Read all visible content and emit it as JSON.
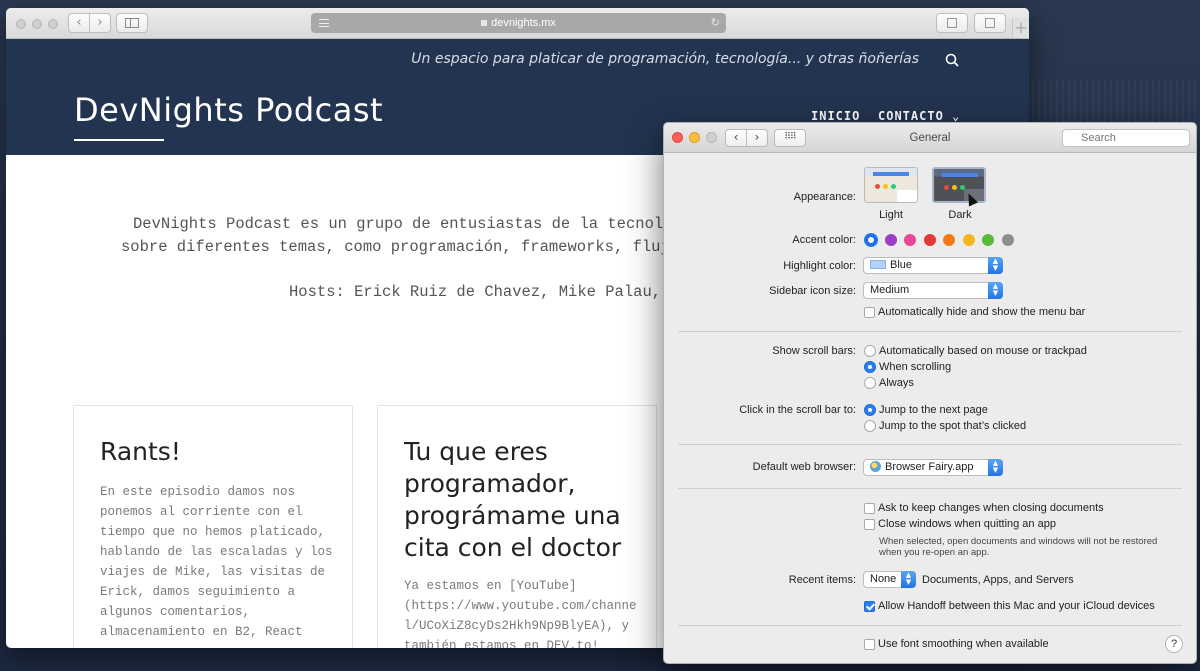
{
  "browser": {
    "url": "devnights.mx",
    "back_label": "‹",
    "forward_label": "›",
    "new_tab_label": "+"
  },
  "site": {
    "tagline": "Un espacio para platicar de programación, tecnología... y otras ñoñerías",
    "title": "DevNights Podcast",
    "nav": [
      "INICIO",
      "CONTACTO ⌄"
    ],
    "intro_line1": "DevNights Podcast es un grupo de entusiastas de la tecnología",
    "intro_line2": "sobre diferentes temas, como programación, frameworks, flujos d",
    "hosts": "Hosts: Erick Ruiz de Chavez, Mike Palau, Dav",
    "cards": [
      {
        "title": "Rants!",
        "body": "En este episodio damos nos\nponemos al corriente con el\ntiempo que no hemos platicado,\nhablando de las escaladas y los\nviajes de Mike, las visitas de\nErick, damos seguimiento a\nalgunos comentarios,\nalmacenamiento en B2, React"
      },
      {
        "title": "Tu que eres programador, prográmame una cita con el doctor",
        "body": "Ya estamos en [YouTube]\n(https://www.youtube.com/channe\nl/UCoXiZ8cyDs2Hkh9Np9BlyEA), y\ntambién estamos en DEV.to!"
      }
    ]
  },
  "prefs": {
    "window_title": "General",
    "search_placeholder": "Search",
    "back_label": "‹",
    "forward_label": "›",
    "grid_label": "⠿⠿",
    "appearance_label": "Appearance:",
    "appearance_light": "Light",
    "appearance_dark": "Dark",
    "accent_label": "Accent color:",
    "accent_colors": [
      "#1e6ff0",
      "#9b3fbf",
      "#e8479a",
      "#e5383b",
      "#f27c1a",
      "#f4b61a",
      "#5cb93a",
      "#8e8e8e"
    ],
    "highlight_label": "Highlight color:",
    "highlight_value": "Blue",
    "sidebar_label": "Sidebar icon size:",
    "sidebar_value": "Medium",
    "menu_bar_cb": "Automatically hide and show the menu bar",
    "scroll_label": "Show scroll bars:",
    "scroll_options": [
      "Automatically based on mouse or trackpad",
      "When scrolling",
      "Always"
    ],
    "click_label": "Click in the scroll bar to:",
    "click_options": [
      "Jump to the next page",
      "Jump to the spot that’s clicked"
    ],
    "browser_label": "Default web browser:",
    "browser_value": "Browser Fairy.app",
    "ask_changes_cb": "Ask to keep changes when closing documents",
    "close_windows_cb": "Close windows when quitting an app",
    "close_note1": "When selected, open documents and windows will not be restored",
    "close_note2": "when you re-open an app.",
    "recent_label": "Recent items:",
    "recent_value": "None",
    "recent_suffix": "Documents, Apps, and Servers",
    "handoff_cb": "Allow Handoff between this Mac and your iCloud devices",
    "font_smoothing_cb": "Use font smoothing when available",
    "help_label": "?"
  }
}
